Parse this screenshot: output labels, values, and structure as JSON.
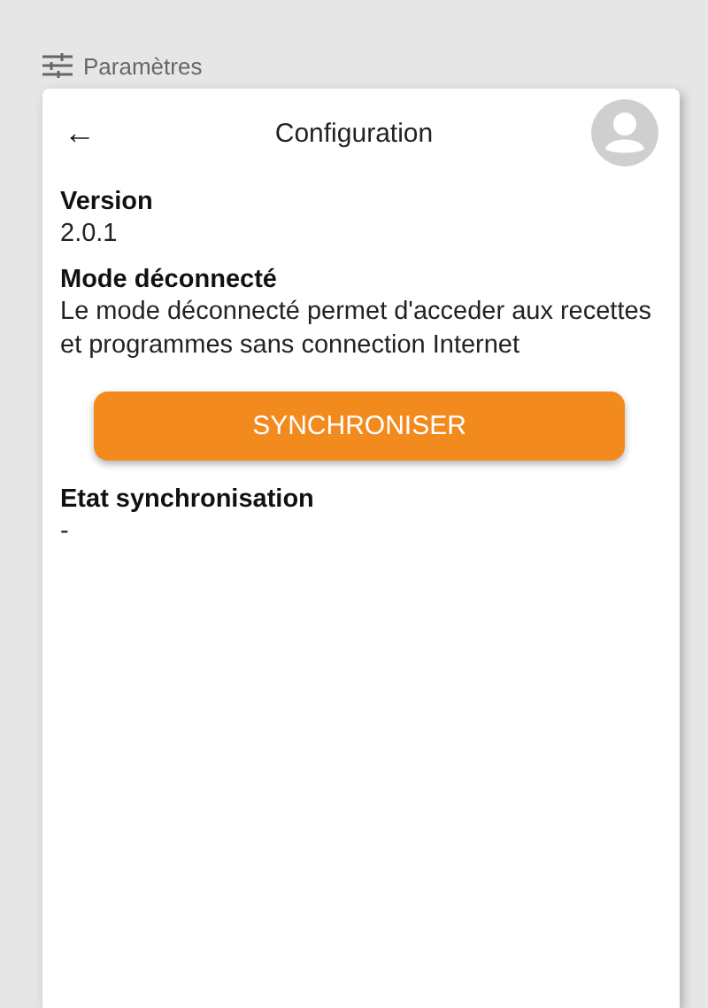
{
  "breadcrumb": {
    "label": "Paramètres"
  },
  "header": {
    "title": "Configuration",
    "back": "←"
  },
  "sections": [
    {
      "label": "Version",
      "text": "2.0.1"
    },
    {
      "label": "Mode déconnecté",
      "text": "Le mode déconnecté permet d'acceder aux recettes et programmes sans connection Internet"
    }
  ],
  "sync_button": {
    "label": "SYNCHRONISER"
  },
  "status": {
    "label": "Etat synchronisation",
    "text": "-"
  }
}
